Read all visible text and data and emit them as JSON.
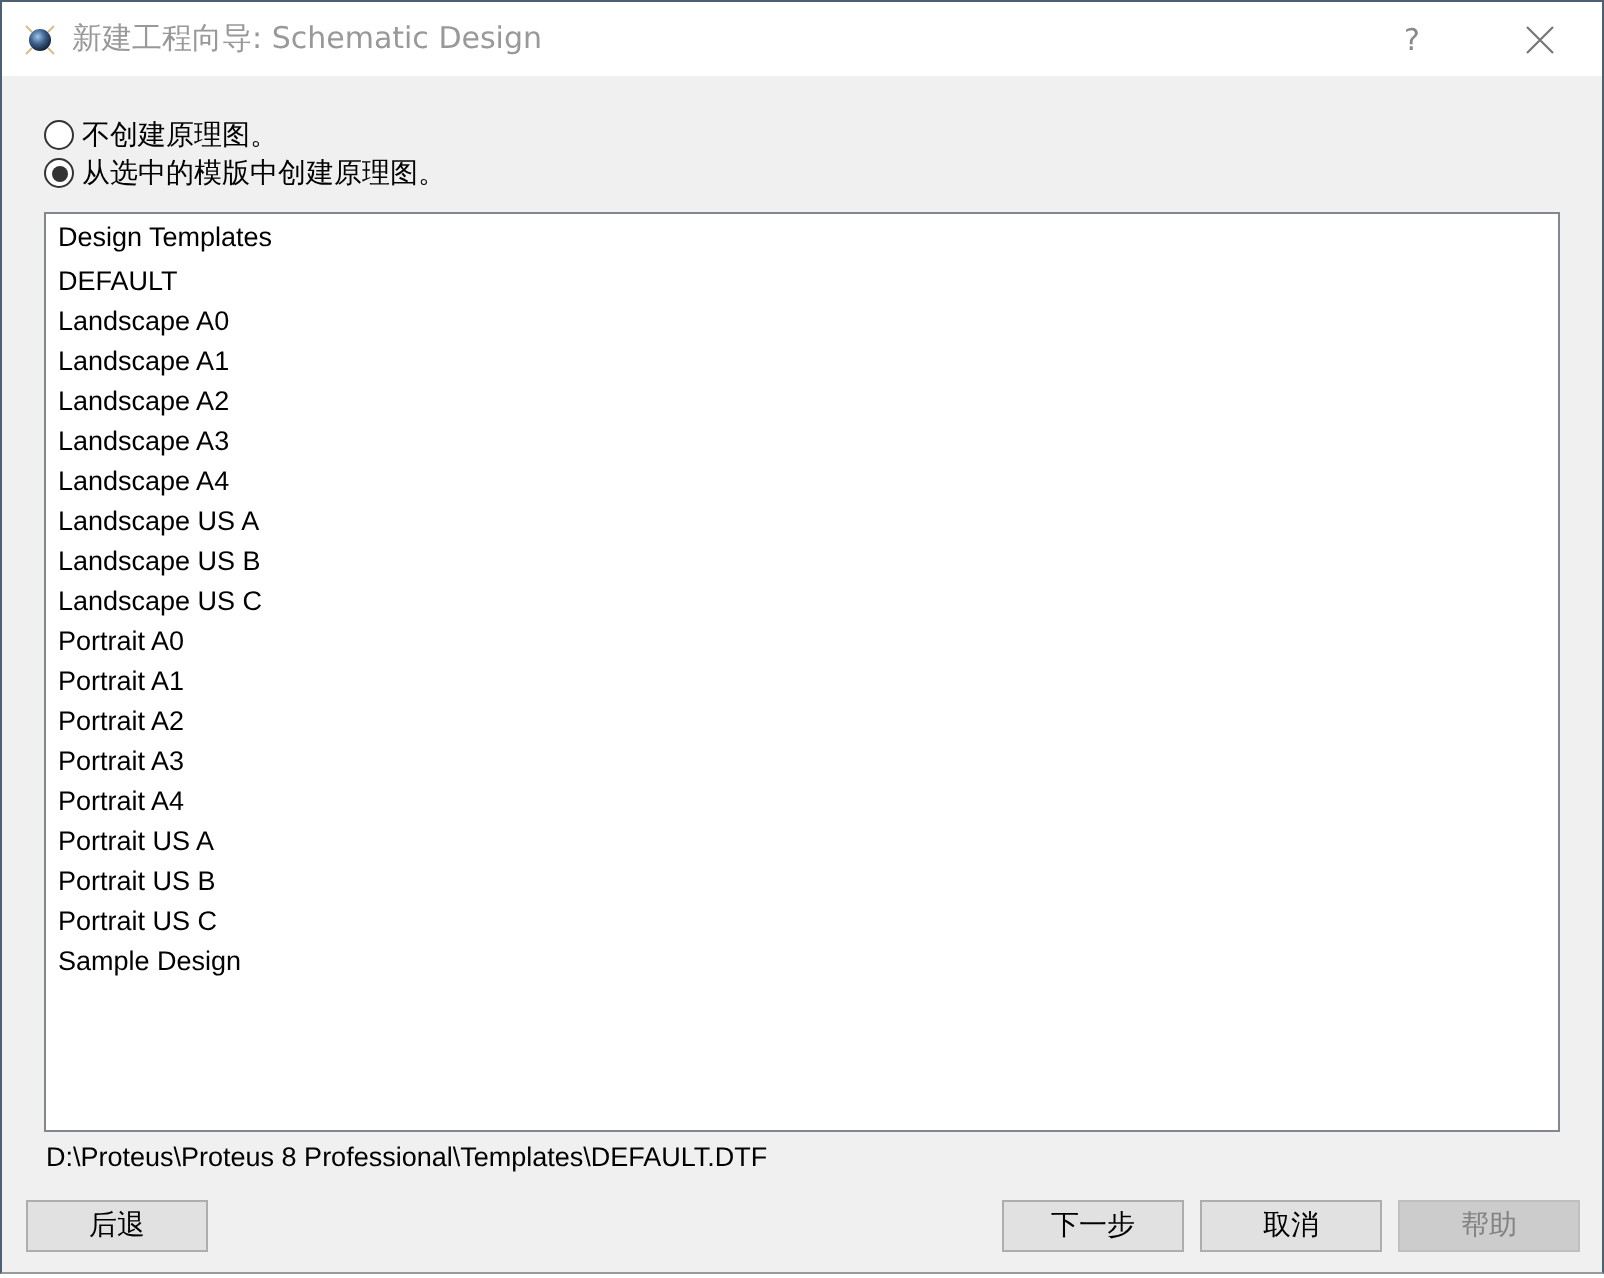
{
  "window": {
    "title": "新建工程向导: Schematic Design",
    "active": false,
    "help_glyph": "?"
  },
  "options": [
    {
      "label": "不创建原理图。",
      "selected": false
    },
    {
      "label": "从选中的模版中创建原理图。",
      "selected": true
    }
  ],
  "template_list": {
    "heading": "Design Templates",
    "items": [
      "DEFAULT",
      "Landscape A0",
      "Landscape A1",
      "Landscape A2",
      "Landscape A3",
      "Landscape A4",
      "Landscape US A",
      "Landscape US B",
      "Landscape US C",
      "Portrait A0",
      "Portrait A1",
      "Portrait A2",
      "Portrait A3",
      "Portrait A4",
      "Portrait US A",
      "Portrait US B",
      "Portrait US C",
      "Sample Design"
    ]
  },
  "path": "D:\\Proteus\\Proteus 8 Professional\\Templates\\DEFAULT.DTF",
  "buttons": [
    {
      "label": "后退",
      "disabled": false,
      "kind": "left"
    },
    {
      "label": "下一步",
      "disabled": false,
      "kind": "right"
    },
    {
      "label": "取消",
      "disabled": false,
      "kind": "right"
    },
    {
      "label": "帮助",
      "disabled": true,
      "kind": "right"
    }
  ]
}
